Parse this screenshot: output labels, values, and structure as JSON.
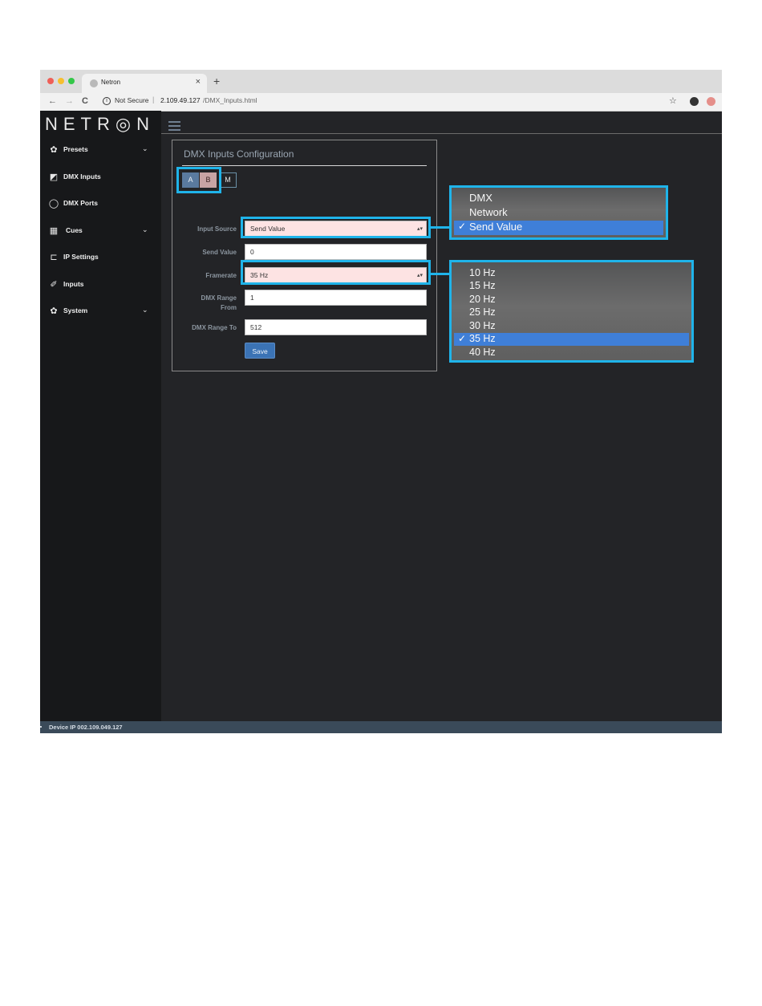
{
  "browser": {
    "tab_title": "Netron",
    "tab_close": "×",
    "new_tab": "+",
    "not_secure": "Not Secure",
    "separator": "|",
    "url_host": "2.109.49.127",
    "url_path": "/DMX_Inputs.html",
    "back": "←",
    "forward": "→",
    "reload": "C",
    "info": "i",
    "star": "☆",
    "traffic_colors": [
      "#ef5f57",
      "#f6bf2f",
      "#33c748"
    ]
  },
  "sidebar": {
    "logo": "NETR◎N",
    "items": [
      {
        "label": "Presets",
        "icon": "gear-icon",
        "glyph": "✿",
        "chevron": "⌄"
      },
      {
        "label": "DMX Inputs",
        "icon": "input-icon",
        "glyph": "◩",
        "chevron": ""
      },
      {
        "label": "DMX Ports",
        "icon": "circle-icon",
        "glyph": "◯",
        "chevron": ""
      },
      {
        "label": "Cues",
        "icon": "film-icon",
        "glyph": "▦",
        "chevron": "⌄"
      },
      {
        "label": "IP Settings",
        "icon": "laptop-icon",
        "glyph": "⊏",
        "chevron": ""
      },
      {
        "label": "Inputs",
        "icon": "plug-icon",
        "glyph": "✐",
        "chevron": ""
      },
      {
        "label": "System",
        "icon": "gear-icon",
        "glyph": "✿",
        "chevron": "⌄"
      }
    ]
  },
  "panel": {
    "title": "DMX Inputs Configuration",
    "segments": [
      "A",
      "B",
      "M"
    ],
    "fields": {
      "input_source": {
        "label": "Input Source",
        "value": "Send Value"
      },
      "send_value": {
        "label": "Send Value",
        "value": "0"
      },
      "framerate": {
        "label": "Framerate",
        "value": "35 Hz"
      },
      "dmx_range_from": {
        "label_line1": "DMX Range",
        "label_line2": "From",
        "value": "1"
      },
      "dmx_range_to": {
        "label": "DMX Range To",
        "value": "512"
      }
    },
    "save_label": "Save",
    "spinner": "▴▾"
  },
  "status": {
    "text": "Device IP 002.109.049.127"
  },
  "callouts": {
    "input_source_options": {
      "options": [
        "DMX",
        "Network",
        "Send Value"
      ],
      "selected": "Send Value",
      "check": "✓"
    },
    "framerate_options": {
      "options": [
        "10 Hz",
        "15 Hz",
        "20 Hz",
        "25 Hz",
        "30 Hz",
        "35 Hz",
        "40 Hz"
      ],
      "selected": "35 Hz",
      "check": "✓"
    }
  },
  "colors": {
    "highlight": "#1fb4ea",
    "selected_option": "#3f7fd8",
    "save_button": "#3b73b5",
    "select_bg": "#fde3e3"
  }
}
